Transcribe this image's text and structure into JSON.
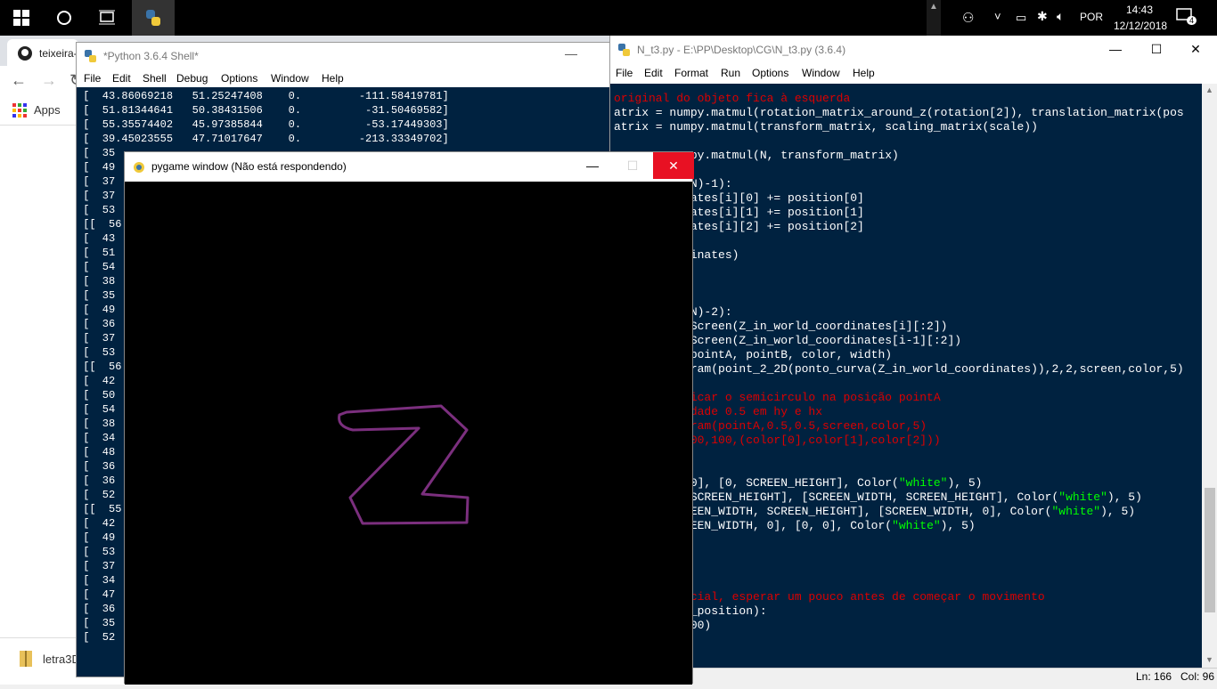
{
  "taskbar": {
    "time": "14:43",
    "date": "12/12/2018",
    "language": "POR",
    "notification_count": "4"
  },
  "chrome": {
    "tab_label": "teixeira-",
    "bookmarks_apps": "Apps",
    "download_item": "letra3D"
  },
  "shell": {
    "title": "*Python 3.6.4 Shell*",
    "menu": [
      "File",
      "Edit",
      "Shell",
      "Debug",
      "Options",
      "Window",
      "Help"
    ],
    "lines": [
      " [  43.86069218   51.25247408    0.         -111.58419781]",
      " [  51.81344641   50.38431506    0.          -31.50469582]",
      " [  55.35574402   45.97385844    0.          -53.17449303]",
      " [  39.45023555   47.71017647    0.         -213.33349702]",
      " [  35",
      " [  49",
      " [  37",
      " [  37",
      " [  53",
      " [[  56",
      " [  43",
      " [  51",
      " [  54",
      " [  38",
      " [  35",
      " [  49",
      " [  36",
      " [  37",
      " [  53",
      " [[  56",
      " [  42",
      " [  50",
      " [  54",
      " [  38",
      " [  34",
      " [  48",
      " [  36",
      " [  36",
      " [  52",
      " [[  55",
      " [  42",
      " [  49",
      " [  53",
      " [  37",
      " [  34",
      " [  47",
      " [  36",
      " [  35",
      " [  52"
    ]
  },
  "editor": {
    "title": "N_t3.py - E:\\PP\\Desktop\\CG\\N_t3.py (3.6.4)",
    "menu": [
      "File",
      "Edit",
      "Format",
      "Run",
      "Options",
      "Window",
      "Help"
    ],
    "status_line": "Ln: 166",
    "status_col": "Col: 96",
    "code_lines": [
      {
        "text": "original do objeto fica à esquerda",
        "cls": "cmt"
      },
      {
        "text": "atrix = numpy.matmul(rotation_matrix_around_z(rotation[2]), translation_matrix(pos",
        "cls": ""
      },
      {
        "text": "atrix = numpy.matmul(transform_matrix, scaling_matrix(scale))",
        "cls": ""
      },
      {
        "text": "",
        "cls": ""
      },
      {
        "text": "      = numpy.matmul(N, transform_matrix)",
        "cls": ""
      },
      {
        "text": "",
        "cls": ""
      },
      {
        "text": "           N)-1):",
        "cls": ""
      },
      {
        "text": "           ates[i][0] += position[0]",
        "cls": ""
      },
      {
        "text": "           ates[i][1] += position[1]",
        "cls": ""
      },
      {
        "text": "           ates[i][2] += position[2]",
        "cls": ""
      },
      {
        "text": "",
        "cls": ""
      },
      {
        "text": "           inates)",
        "cls": ""
      },
      {
        "text": "",
        "cls": ""
      },
      {
        "text": "",
        "cls": ""
      },
      {
        "text": "",
        "cls": ""
      },
      {
        "text": "           N)-2):",
        "cls": ""
      },
      {
        "text": "           Screen(Z_in_world_coordinates[i][:2])",
        "cls": ""
      },
      {
        "text": "           Screen(Z_in_world_coordinates[i-1][:2])",
        "cls": ""
      },
      {
        "text": "           pointA, pointB, color, width)",
        "cls": ""
      },
      {
        "text": "           ram(point_2_2D(ponto_curva(Z_in_world_coordinates)),2,2,screen,color,5)",
        "cls": ""
      },
      {
        "text": "",
        "cls": ""
      },
      {
        "text": "           icar o semicirculo na posição pointA",
        "cls": "cmt"
      },
      {
        "text": "           dade 0.5 em hy e hx",
        "cls": "cmt"
      },
      {
        "text": "           ram(pointA,0.5,0.5,screen,color,5)",
        "cls": "cmt"
      },
      {
        "text": "           00,100,(color[0],color[1],color[2]))",
        "cls": "cmt"
      },
      {
        "text": "",
        "cls": ""
      },
      {
        "text": "",
        "cls": ""
      },
      {
        "text": "           0], [0, SCREEN_HEIGHT], Color(\"white\"), 5)",
        "cls": "",
        "str": true
      },
      {
        "text": "           SCREEN_HEIGHT], [SCREEN_WIDTH, SCREEN_HEIGHT], Color(\"white\"), 5)",
        "cls": "",
        "str": true
      },
      {
        "text": "           EEN_WIDTH, SCREEN_HEIGHT], [SCREEN_WIDTH, 0], Color(\"white\"), 5)",
        "cls": "",
        "str": true
      },
      {
        "text": "           EEN_WIDTH, 0], [0, 0], Color(\"white\"), 5)",
        "cls": "",
        "str": true
      },
      {
        "text": "",
        "cls": ""
      },
      {
        "text": "",
        "cls": ""
      },
      {
        "text": "",
        "cls": ""
      },
      {
        "text": "",
        "cls": ""
      },
      {
        "text": "           cial, esperar um pouco antes de começar o movimento",
        "cls": "cmt"
      },
      {
        "text": "           _position):",
        "cls": ""
      },
      {
        "text": "           00)",
        "cls": ""
      }
    ]
  },
  "pygame": {
    "title": "pygame window (Não está respondendo)",
    "shape_color": "#7b2f7e"
  }
}
